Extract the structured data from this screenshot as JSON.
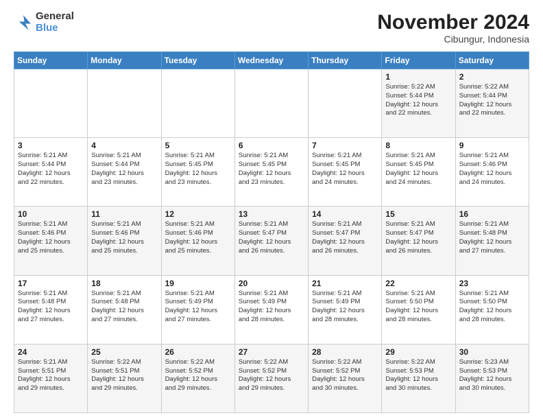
{
  "header": {
    "logo_line1": "General",
    "logo_line2": "Blue",
    "month": "November 2024",
    "location": "Cibungur, Indonesia"
  },
  "weekdays": [
    "Sunday",
    "Monday",
    "Tuesday",
    "Wednesday",
    "Thursday",
    "Friday",
    "Saturday"
  ],
  "weeks": [
    [
      {
        "day": "",
        "info": ""
      },
      {
        "day": "",
        "info": ""
      },
      {
        "day": "",
        "info": ""
      },
      {
        "day": "",
        "info": ""
      },
      {
        "day": "",
        "info": ""
      },
      {
        "day": "1",
        "info": "Sunrise: 5:22 AM\nSunset: 5:44 PM\nDaylight: 12 hours\nand 22 minutes."
      },
      {
        "day": "2",
        "info": "Sunrise: 5:22 AM\nSunset: 5:44 PM\nDaylight: 12 hours\nand 22 minutes."
      }
    ],
    [
      {
        "day": "3",
        "info": "Sunrise: 5:21 AM\nSunset: 5:44 PM\nDaylight: 12 hours\nand 22 minutes."
      },
      {
        "day": "4",
        "info": "Sunrise: 5:21 AM\nSunset: 5:44 PM\nDaylight: 12 hours\nand 23 minutes."
      },
      {
        "day": "5",
        "info": "Sunrise: 5:21 AM\nSunset: 5:45 PM\nDaylight: 12 hours\nand 23 minutes."
      },
      {
        "day": "6",
        "info": "Sunrise: 5:21 AM\nSunset: 5:45 PM\nDaylight: 12 hours\nand 23 minutes."
      },
      {
        "day": "7",
        "info": "Sunrise: 5:21 AM\nSunset: 5:45 PM\nDaylight: 12 hours\nand 24 minutes."
      },
      {
        "day": "8",
        "info": "Sunrise: 5:21 AM\nSunset: 5:45 PM\nDaylight: 12 hours\nand 24 minutes."
      },
      {
        "day": "9",
        "info": "Sunrise: 5:21 AM\nSunset: 5:46 PM\nDaylight: 12 hours\nand 24 minutes."
      }
    ],
    [
      {
        "day": "10",
        "info": "Sunrise: 5:21 AM\nSunset: 5:46 PM\nDaylight: 12 hours\nand 25 minutes."
      },
      {
        "day": "11",
        "info": "Sunrise: 5:21 AM\nSunset: 5:46 PM\nDaylight: 12 hours\nand 25 minutes."
      },
      {
        "day": "12",
        "info": "Sunrise: 5:21 AM\nSunset: 5:46 PM\nDaylight: 12 hours\nand 25 minutes."
      },
      {
        "day": "13",
        "info": "Sunrise: 5:21 AM\nSunset: 5:47 PM\nDaylight: 12 hours\nand 26 minutes."
      },
      {
        "day": "14",
        "info": "Sunrise: 5:21 AM\nSunset: 5:47 PM\nDaylight: 12 hours\nand 26 minutes."
      },
      {
        "day": "15",
        "info": "Sunrise: 5:21 AM\nSunset: 5:47 PM\nDaylight: 12 hours\nand 26 minutes."
      },
      {
        "day": "16",
        "info": "Sunrise: 5:21 AM\nSunset: 5:48 PM\nDaylight: 12 hours\nand 27 minutes."
      }
    ],
    [
      {
        "day": "17",
        "info": "Sunrise: 5:21 AM\nSunset: 5:48 PM\nDaylight: 12 hours\nand 27 minutes."
      },
      {
        "day": "18",
        "info": "Sunrise: 5:21 AM\nSunset: 5:48 PM\nDaylight: 12 hours\nand 27 minutes."
      },
      {
        "day": "19",
        "info": "Sunrise: 5:21 AM\nSunset: 5:49 PM\nDaylight: 12 hours\nand 27 minutes."
      },
      {
        "day": "20",
        "info": "Sunrise: 5:21 AM\nSunset: 5:49 PM\nDaylight: 12 hours\nand 28 minutes."
      },
      {
        "day": "21",
        "info": "Sunrise: 5:21 AM\nSunset: 5:49 PM\nDaylight: 12 hours\nand 28 minutes."
      },
      {
        "day": "22",
        "info": "Sunrise: 5:21 AM\nSunset: 5:50 PM\nDaylight: 12 hours\nand 28 minutes."
      },
      {
        "day": "23",
        "info": "Sunrise: 5:21 AM\nSunset: 5:50 PM\nDaylight: 12 hours\nand 28 minutes."
      }
    ],
    [
      {
        "day": "24",
        "info": "Sunrise: 5:21 AM\nSunset: 5:51 PM\nDaylight: 12 hours\nand 29 minutes."
      },
      {
        "day": "25",
        "info": "Sunrise: 5:22 AM\nSunset: 5:51 PM\nDaylight: 12 hours\nand 29 minutes."
      },
      {
        "day": "26",
        "info": "Sunrise: 5:22 AM\nSunset: 5:52 PM\nDaylight: 12 hours\nand 29 minutes."
      },
      {
        "day": "27",
        "info": "Sunrise: 5:22 AM\nSunset: 5:52 PM\nDaylight: 12 hours\nand 29 minutes."
      },
      {
        "day": "28",
        "info": "Sunrise: 5:22 AM\nSunset: 5:52 PM\nDaylight: 12 hours\nand 30 minutes."
      },
      {
        "day": "29",
        "info": "Sunrise: 5:22 AM\nSunset: 5:53 PM\nDaylight: 12 hours\nand 30 minutes."
      },
      {
        "day": "30",
        "info": "Sunrise: 5:23 AM\nSunset: 5:53 PM\nDaylight: 12 hours\nand 30 minutes."
      }
    ]
  ]
}
